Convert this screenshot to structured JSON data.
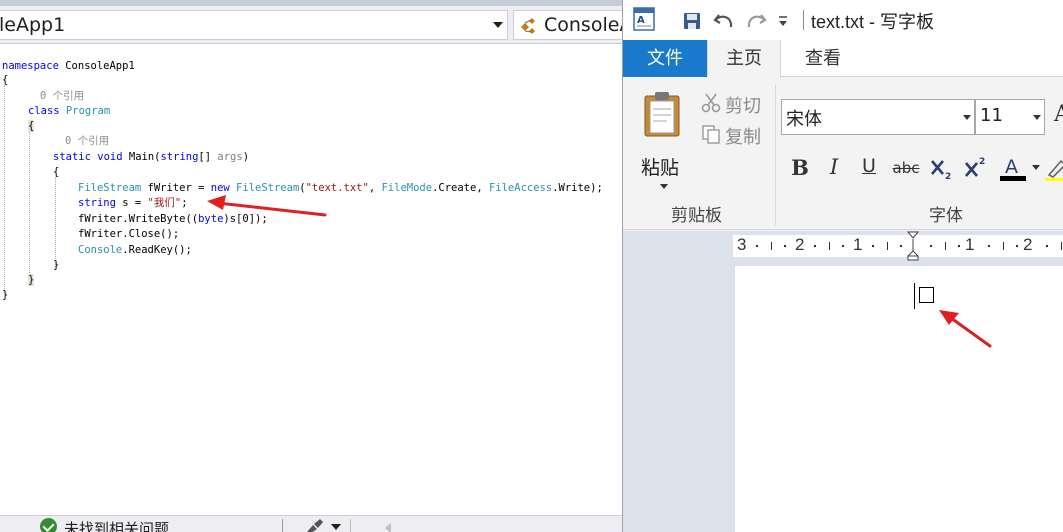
{
  "vs": {
    "project_combo": "leApp1",
    "class_combo": "ConsoleA",
    "code": {
      "l1_kw": "namespace",
      "l1_name": " ConsoleApp1",
      "l2": "{",
      "l3_refs": "0 个引用",
      "l4_kw": "class",
      "l4_type": " Program",
      "l5": "{",
      "l6_refs": "0 个引用",
      "l7_kw1": "static",
      "l7_kw2": " void",
      "l7_rest1": " Main(",
      "l7_kw3": "string",
      "l7_rest2": "[] ",
      "l7_param": "args",
      "l7_rest3": ")",
      "l8": "{",
      "l9_t1": "FileStream",
      "l9_r1": " fWriter = ",
      "l9_kw": "new",
      "l9_t2": " FileStream",
      "l9_r2": "(",
      "l9_s": "\"text.txt\"",
      "l9_r3": ", ",
      "l9_t3": "FileMode",
      "l9_r4": ".Create, ",
      "l9_t4": "FileAccess",
      "l9_r5": ".Write);",
      "l10_kw": "string",
      "l10_r1": " s = ",
      "l10_s": "\"我们\"",
      "l10_r2": ";",
      "l11_r1": "fWriter.WriteByte((",
      "l11_kw": "byte",
      "l11_r2": ")s[0]);",
      "l12": "fWriter.Close();",
      "l13_t": "Console",
      "l13_r": ".ReadKey();",
      "l14": "}",
      "l15": "}",
      "l16": "}"
    },
    "status": {
      "text": "未找到相关问题"
    }
  },
  "wordpad": {
    "title": "text.txt - 写字板",
    "tabs": {
      "file": "文件",
      "home": "主页",
      "view": "查看"
    },
    "clipboard": {
      "paste": "粘贴",
      "cut": "剪切",
      "copy": "复制",
      "group_label": "剪贴板"
    },
    "font": {
      "name": "宋体",
      "size": "11",
      "group_label": "字体",
      "bold": "B",
      "italic": "I",
      "underline": "U",
      "strike": "abc",
      "grow": "A"
    },
    "ruler": {
      "n1": "3",
      "n2": "2",
      "n3": "1",
      "n4": "1",
      "n5": "2"
    }
  },
  "colors": {
    "file_tab": "#1979ca",
    "annotation_arrow": "#e02020",
    "keyword": "#0000ff",
    "type": "#2b91af",
    "string": "#a31515"
  }
}
